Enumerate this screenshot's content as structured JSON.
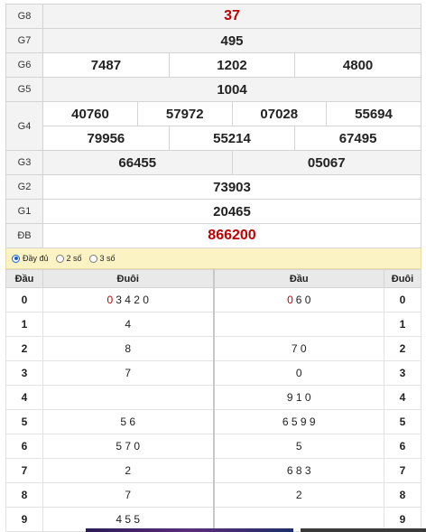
{
  "prizes": [
    {
      "label": "G8",
      "numbers": [
        "37"
      ],
      "red": true
    },
    {
      "label": "G7",
      "numbers": [
        "495"
      ]
    },
    {
      "label": "G6",
      "numbers": [
        "7487",
        "1202",
        "4800"
      ]
    },
    {
      "label": "G5",
      "numbers": [
        "1004"
      ]
    },
    {
      "label": "G4",
      "numbers": [
        "40760",
        "57972",
        "07028",
        "55694",
        "79956",
        "55214",
        "67495"
      ]
    },
    {
      "label": "G3",
      "numbers": [
        "66455",
        "05067"
      ]
    },
    {
      "label": "G2",
      "numbers": [
        "73903"
      ]
    },
    {
      "label": "G1",
      "numbers": [
        "20465"
      ]
    },
    {
      "label": "ĐB",
      "numbers": [
        "866200"
      ],
      "red": true
    }
  ],
  "options": [
    {
      "label": "Đầy đủ",
      "selected": true
    },
    {
      "label": "2 số",
      "selected": false
    },
    {
      "label": "3 số",
      "selected": false
    }
  ],
  "loto": {
    "headers": [
      "Đầu",
      "Đuôi",
      "Đầu",
      "Đuôi"
    ],
    "rows": [
      {
        "dau": "0",
        "duoi_red": "0",
        "duoi_rest": "3 4 2 0",
        "dau2_red": "0",
        "dau2_rest": "6 0",
        "duoi2": "0"
      },
      {
        "dau": "1",
        "duoi_red": "",
        "duoi_rest": "4",
        "dau2_red": "",
        "dau2_rest": "",
        "duoi2": "1"
      },
      {
        "dau": "2",
        "duoi_red": "",
        "duoi_rest": "8",
        "dau2_red": "",
        "dau2_rest": "7 0",
        "duoi2": "2"
      },
      {
        "dau": "3",
        "duoi_red": "",
        "duoi_rest": "7",
        "dau2_red": "",
        "dau2_rest": "0",
        "duoi2": "3"
      },
      {
        "dau": "4",
        "duoi_red": "",
        "duoi_rest": "",
        "dau2_red": "",
        "dau2_rest": "9 1 0",
        "duoi2": "4"
      },
      {
        "dau": "5",
        "duoi_red": "",
        "duoi_rest": "5 6",
        "dau2_red": "",
        "dau2_rest": "6 5 9 9",
        "duoi2": "5"
      },
      {
        "dau": "6",
        "duoi_red": "",
        "duoi_rest": "5 7 0",
        "dau2_red": "",
        "dau2_rest": "5",
        "duoi2": "6"
      },
      {
        "dau": "7",
        "duoi_red": "",
        "duoi_rest": "2",
        "dau2_red": "",
        "dau2_rest": "6 8 3",
        "duoi2": "7"
      },
      {
        "dau": "8",
        "duoi_red": "",
        "duoi_rest": "7",
        "dau2_red": "",
        "dau2_rest": "2",
        "duoi2": "8"
      },
      {
        "dau": "9",
        "duoi_red": "",
        "duoi_rest": "4 5 5",
        "dau2_red": "",
        "dau2_rest": "",
        "duoi2": "9"
      }
    ]
  },
  "colors": {
    "red": "#c00000",
    "options_bg": "#fcf3c5",
    "radio_on": "#1a5fd0"
  }
}
